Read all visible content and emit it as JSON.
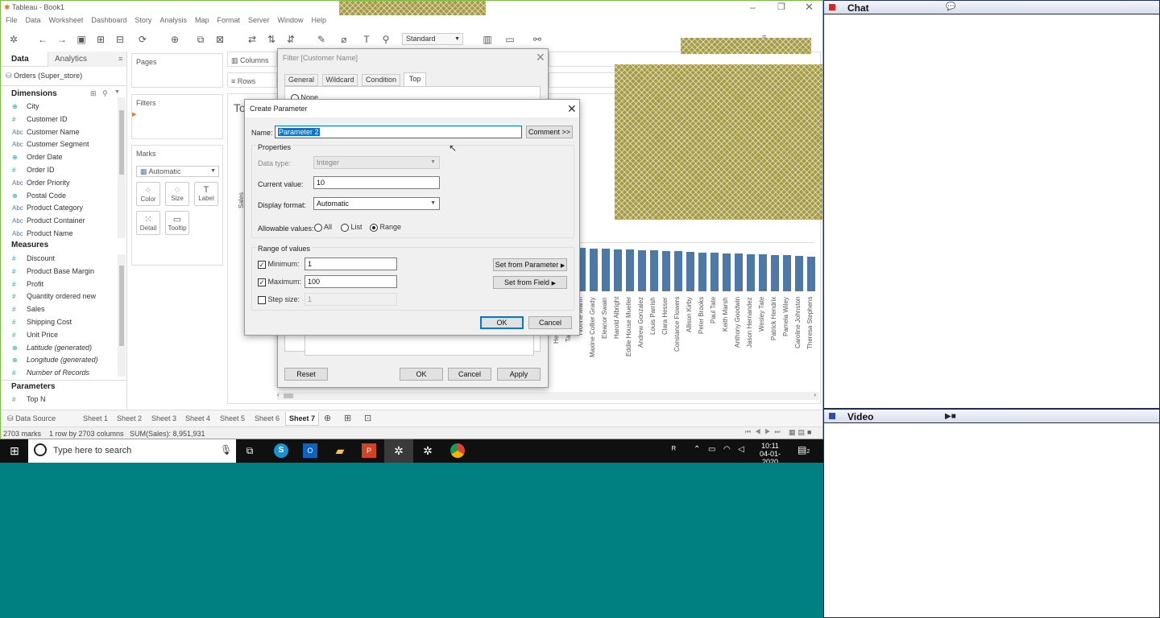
{
  "window": {
    "title": "Tableau - Book1"
  },
  "menu": [
    "File",
    "Data",
    "Worksheet",
    "Dashboard",
    "Story",
    "Analysis",
    "Map",
    "Format",
    "Server",
    "Window",
    "Help"
  ],
  "toolbar": {
    "fit_select": "Standard"
  },
  "data_pane": {
    "tab_data": "Data",
    "tab_analytics": "Analytics",
    "datasource": "Orders (Super_store)",
    "dimensions_label": "Dimensions",
    "dimensions": [
      {
        "icon": "globe",
        "label": "City"
      },
      {
        "icon": "#",
        "label": "Customer ID"
      },
      {
        "icon": "Abc",
        "label": "Customer Name"
      },
      {
        "icon": "Abc",
        "label": "Customer Segment"
      },
      {
        "icon": "date",
        "label": "Order Date"
      },
      {
        "icon": "#",
        "label": "Order ID"
      },
      {
        "icon": "Abc",
        "label": "Order Priority"
      },
      {
        "icon": "globe",
        "label": "Postal Code"
      },
      {
        "icon": "Abc",
        "label": "Product Category"
      },
      {
        "icon": "Abc",
        "label": "Product Container"
      },
      {
        "icon": "Abc",
        "label": "Product Name"
      }
    ],
    "measures_label": "Measures",
    "measures": [
      {
        "icon": "#",
        "label": "Discount"
      },
      {
        "icon": "#",
        "label": "Product Base Margin"
      },
      {
        "icon": "#",
        "label": "Profit"
      },
      {
        "icon": "#",
        "label": "Quantity ordered new"
      },
      {
        "icon": "#",
        "label": "Sales"
      },
      {
        "icon": "#",
        "label": "Shipping Cost"
      },
      {
        "icon": "#",
        "label": "Unit Price"
      },
      {
        "icon": "globe",
        "label": "Latitude (generated)"
      },
      {
        "icon": "globe",
        "label": "Longitude (generated)"
      },
      {
        "icon": "#",
        "label": "Number of Records"
      }
    ],
    "parameters_label": "Parameters",
    "parameters": [
      {
        "icon": "#",
        "label": "Top N"
      }
    ]
  },
  "shelves": {
    "pages": "Pages",
    "filters": "Filters",
    "marks": "Marks",
    "marks_type": "Automatic",
    "mark_buttons": [
      "Color",
      "Size",
      "Label",
      "Detail",
      "Tooltip"
    ],
    "columns": "Columns",
    "rows": "Rows"
  },
  "filter_dialog": {
    "title": "Filter [Customer Name]",
    "tabs": [
      "General",
      "Wildcard",
      "Condition",
      "Top"
    ],
    "option_none": "None",
    "reset": "Reset",
    "ok": "OK",
    "cancel": "Cancel",
    "apply": "Apply"
  },
  "param_dialog": {
    "title": "Create Parameter",
    "name_label": "Name:",
    "name_value": "Parameter 2",
    "comment_btn": "Comment >>",
    "properties_label": "Properties",
    "datatype_label": "Data type:",
    "datatype_value": "Integer",
    "current_label": "Current value:",
    "current_value": "10",
    "format_label": "Display format:",
    "format_value": "Automatic",
    "allowable_label": "Allowable values:",
    "allow_all": "All",
    "allow_list": "List",
    "allow_range": "Range",
    "range_label": "Range of values",
    "min_label": "Minimum:",
    "min_value": "1",
    "max_label": "Maximum:",
    "max_value": "100",
    "step_label": "Step size:",
    "step_value": "1",
    "set_from_param": "Set from Parameter",
    "set_from_field": "Set from Field",
    "ok": "OK",
    "cancel": "Cancel"
  },
  "view": {
    "title_partial": "To",
    "axis_partial": "Sales"
  },
  "chart_data": {
    "type": "bar",
    "categories": [
      "He",
      "Ta",
      "Yvonne Mann",
      "Maxine Collier Grady",
      "Eleanor Swain",
      "Harold Albright",
      "Eddie House Mueller",
      "Andrew Gonzalez",
      "Louis Parrish",
      "Clara Hesser",
      "Constance Flowers",
      "Allison Kirby",
      "Peter Brooks",
      "Paul Tate",
      "Keith Marsh",
      "Anthony Goodwin",
      "Jason Hernandez",
      "Wesley Tate",
      "Patrick Hendrix",
      "Pamela Wiley",
      "Caroline Johnston",
      "Theresa Stephens"
    ],
    "bar_heights_relative": [
      1.0,
      1.0,
      0.98,
      0.97,
      0.96,
      0.95,
      0.94,
      0.93,
      0.92,
      0.91,
      0.9,
      0.89,
      0.88,
      0.87,
      0.86,
      0.85,
      0.84,
      0.83,
      0.82,
      0.81,
      0.8,
      0.79
    ]
  },
  "sheet_tabs": [
    "Data Source",
    "Sheet 1",
    "Sheet 2",
    "Sheet 3",
    "Sheet 4",
    "Sheet 5",
    "Sheet 6",
    "Sheet 7"
  ],
  "active_sheet": "Sheet 7",
  "status": {
    "marks": "2703 marks",
    "rows": "1 row by 2703 columns",
    "sum": "SUM(Sales): 8,951,931"
  },
  "taskbar": {
    "search_placeholder": "Type here to search",
    "time": "10:11",
    "date": "04-01-2020",
    "notif_count": "2"
  },
  "right_panel": {
    "chat": "Chat",
    "video": "Video"
  },
  "colors": {
    "accent": "#4e79a7",
    "teal": "#008080",
    "frame": "#7ac143"
  }
}
